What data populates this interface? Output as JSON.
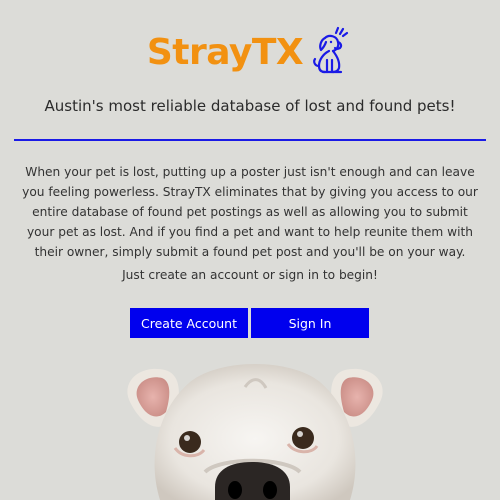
{
  "logo": {
    "text": "StrayTX",
    "icon": "dog-icon",
    "text_color": "#f29111",
    "icon_color": "#1a1ae6"
  },
  "tagline": "Austin's most reliable database of lost and found pets!",
  "description": "When your pet is lost, putting up a poster just isn't enough and can leave you feeling powerless. StrayTX eliminates that by giving you access to our entire database of found pet postings as well as allowing you to submit your pet as lost. And if you find a pet and want to help reunite them with their owner, simply submit a found pet post and you'll be on your way.",
  "cta_text": "Just create an account or sign in to begin!",
  "buttons": {
    "create_account": "Create Account",
    "sign_in": "Sign In",
    "color": "#0000ee"
  },
  "hero_image": {
    "subject": "bulldog-photo"
  }
}
